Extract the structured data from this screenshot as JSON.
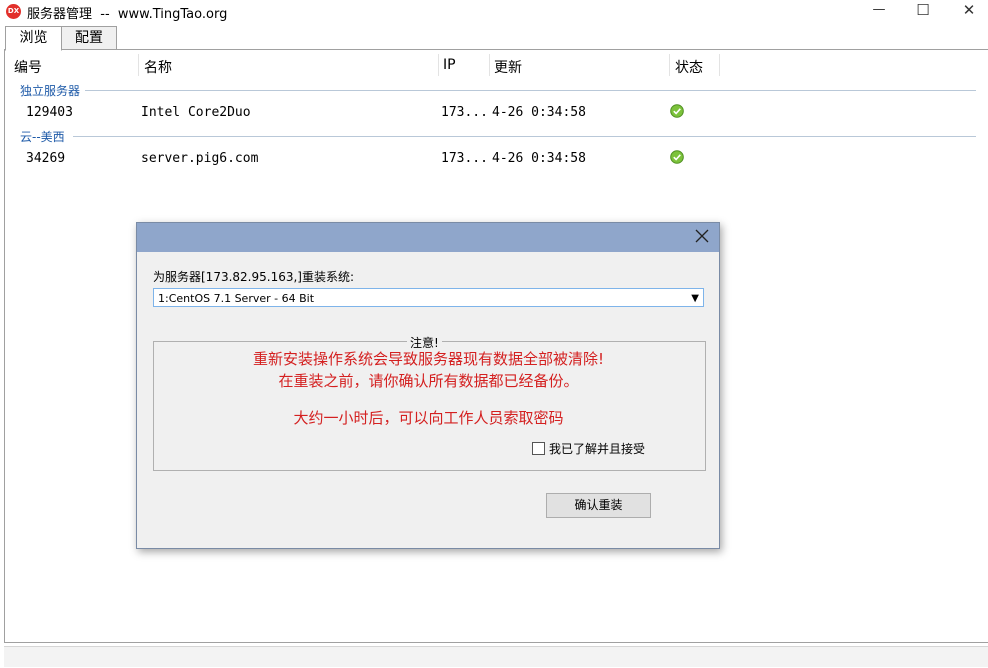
{
  "window": {
    "title": "服务器管理  --  www.TingTao.org",
    "icon_text": "DX",
    "controls": {
      "minimize": "—",
      "maximize": "☐",
      "close": "✕"
    }
  },
  "tabs": [
    {
      "label": "浏览",
      "active": true
    },
    {
      "label": "配置",
      "active": false
    }
  ],
  "table": {
    "columns": [
      "编号",
      "名称",
      "IP",
      "更新",
      "状态"
    ],
    "groups": [
      {
        "name": "独立服务器",
        "rows": [
          {
            "id": "129403",
            "name": "Intel Core2Duo",
            "ip": "173...",
            "updated": "4-26 0:34:58",
            "status": "ok"
          }
        ]
      },
      {
        "name": "云--美西",
        "rows": [
          {
            "id": "34269",
            "name": "server.pig6.com",
            "ip": "173...",
            "updated": "4-26 0:34:58",
            "status": "ok"
          }
        ]
      }
    ]
  },
  "dialog": {
    "label": "为服务器[173.82.95.163,]重装系统:",
    "os_select": {
      "selected": "1:CentOS 7.1 Server - 64 Bit"
    },
    "notice": {
      "title": "注意!",
      "line1": "重新安装操作系统会导致服务器现有数据全部被清除!",
      "line2": "在重装之前，请你确认所有数据都已经备份。",
      "line3": "大约一小时后，可以向工作人员索取密码"
    },
    "accept_label": "我已了解并且接受",
    "accept_checked": false,
    "confirm_button": "确认重装"
  },
  "colors": {
    "group_text": "#1e5aa8",
    "warning_text": "#d42020",
    "dialog_title_bar": "#8fa6cb",
    "status_ok": "#6bb52b"
  }
}
